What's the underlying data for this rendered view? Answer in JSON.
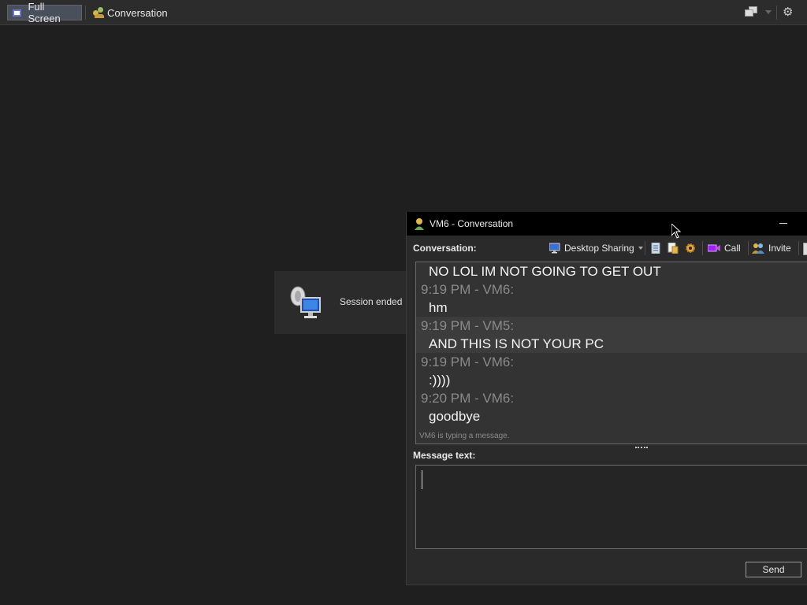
{
  "topbar": {
    "fullscreen_label": "Full Screen",
    "conversation_label": "Conversation"
  },
  "toast": {
    "text": "Session ended"
  },
  "window": {
    "title": "VM6 - Conversation",
    "conversation_label": "Conversation:",
    "toolbar": {
      "desktop_sharing": "Desktop Sharing",
      "call": "Call",
      "invite": "Invite"
    },
    "messages": [
      {
        "kind": "text",
        "value": "NO LOL IM NOT GOING TO GET OUT"
      },
      {
        "kind": "time",
        "value": "9:19 PM - VM6:"
      },
      {
        "kind": "text",
        "value": "hm"
      },
      {
        "kind": "time",
        "value": "9:19 PM - VM5:"
      },
      {
        "kind": "text",
        "value": "AND THIS IS NOT YOUR PC"
      },
      {
        "kind": "time",
        "value": "9:19 PM - VM6:"
      },
      {
        "kind": "text",
        "value": ":))))"
      },
      {
        "kind": "time",
        "value": "9:20 PM - VM6:"
      },
      {
        "kind": "text",
        "value": "goodbye"
      }
    ],
    "typing_status": "VM6 is typing a message.",
    "message_label": "Message text:",
    "message_value": "",
    "send_label": "Send"
  },
  "colors": {
    "background": "#1f1f1f",
    "window_bg": "#2a2a2a",
    "timestamp": "#8a8a8a"
  }
}
